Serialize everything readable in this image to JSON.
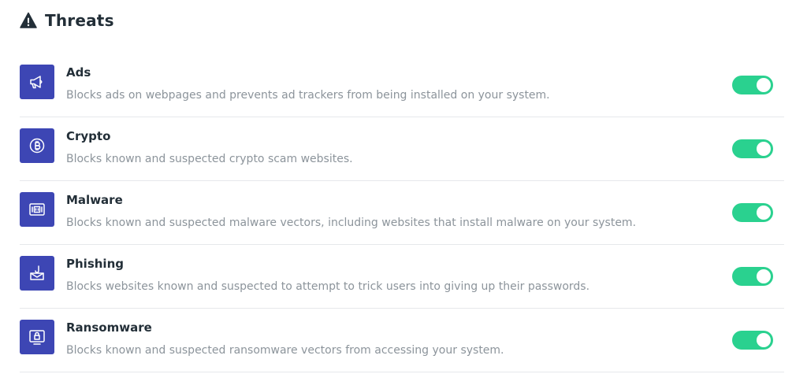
{
  "header": {
    "icon": "warning-icon",
    "title": "Threats"
  },
  "colors": {
    "tile": "#3d46b4",
    "toggle_on": "#2ad18f",
    "description": "#8c949b"
  },
  "threats": [
    {
      "name": "Ads",
      "description": "Blocks ads on webpages and prevents ad trackers from being installed on your system.",
      "icon": "megaphone-icon",
      "enabled": true
    },
    {
      "name": "Crypto",
      "description": "Blocks known and suspected crypto scam websites.",
      "icon": "bitcoin-icon",
      "enabled": true
    },
    {
      "name": "Malware",
      "description": "Blocks known and suspected malware vectors, including websites that install malware on your system.",
      "icon": "chip-icon",
      "enabled": true
    },
    {
      "name": "Phishing",
      "description": "Blocks websites known and suspected to attempt to trick users into giving up their passwords.",
      "icon": "phishing-envelope-icon",
      "enabled": true
    },
    {
      "name": "Ransomware",
      "description": "Blocks known and suspected ransomware vectors from accessing your system.",
      "icon": "lock-screen-icon",
      "enabled": true
    }
  ]
}
